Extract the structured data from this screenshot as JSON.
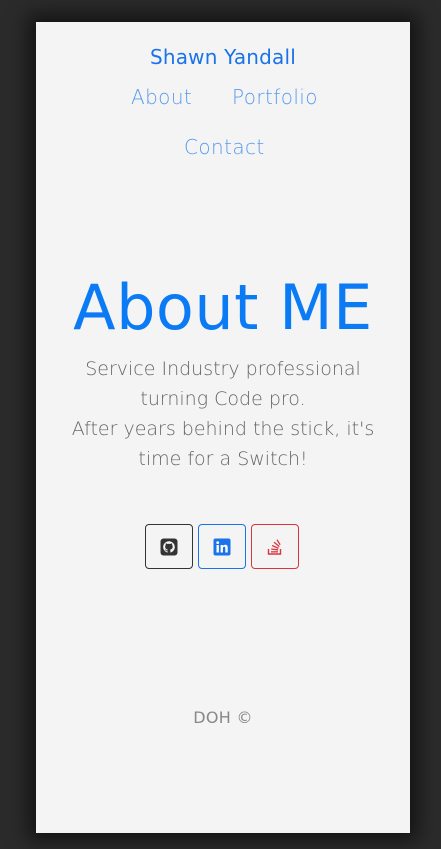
{
  "header": {
    "brand": "Shawn Yandall",
    "nav": {
      "about": "About",
      "portfolio": "Portfolio",
      "contact": "Contact"
    }
  },
  "hero": {
    "title": "About ME",
    "line1": "Service Industry professional",
    "line2": "turning Code pro.",
    "line3": "After years behind the stick, it's",
    "line4": "time for a Switch!"
  },
  "social": [
    {
      "icon": "github-icon",
      "color": "#333333"
    },
    {
      "icon": "linkedin-icon",
      "color": "#1a73e8"
    },
    {
      "icon": "stack-overflow-icon",
      "color": "#d9343f"
    }
  ],
  "footer": {
    "text": "DOH ©"
  },
  "colors": {
    "page_background": "#2b2b2b",
    "card_background": "#f4f4f4",
    "accent": "#0a7af5",
    "nav_link": "#5a9bef"
  }
}
